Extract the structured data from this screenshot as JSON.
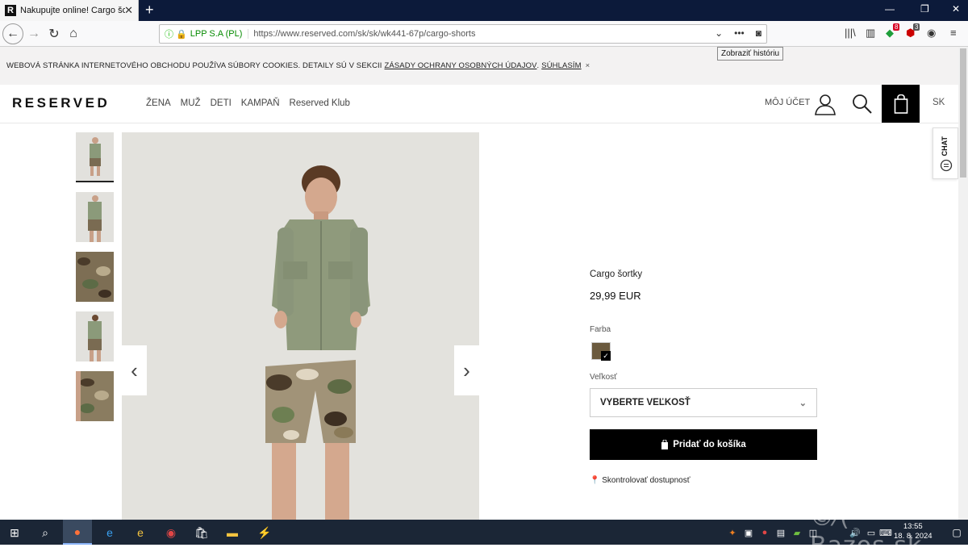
{
  "browser": {
    "tab_title": "Nakupujte online! Cargo šortky",
    "favicon_letter": "R",
    "site_identity": "LPP S.A (PL)",
    "url": "https://www.reserved.com/sk/sk/wk441-67p/cargo-shorts",
    "tooltip": "Zobraziť históriu",
    "badge_1": "8",
    "badge_2": "3"
  },
  "cookie_bar": {
    "text": "WEBOVÁ STRÁNKA INTERNETOVÉHO OBCHODU POUŽÍVA SÚBORY COOKIES. DETAILY SÚ V SEKCII",
    "link": "ZÁSADY OCHRANY OSOBNÝCH ÚDAJOV",
    "sep": ".",
    "accept": "SÚHLASÍM",
    "close": "×"
  },
  "header": {
    "logo": "RESERVED",
    "menu": [
      "ŽENA",
      "MUŽ",
      "DETI",
      "KAMPAŇ",
      "Reserved Klub"
    ],
    "account": "MÔJ ÚČET",
    "lang": "SK"
  },
  "chat": {
    "label": "CHAT"
  },
  "product": {
    "name": "Cargo šortky",
    "price": "29,99 EUR",
    "color_label": "Farba",
    "size_label": "Veľkosť",
    "size_select": "VYBERTE VEĽKOSŤ",
    "add_button": "Pridať do košíka",
    "availability": "Skontrolovať dostupnosť",
    "swatch_color": "#6b5a3e"
  },
  "taskbar": {
    "time": "13:55",
    "date": "18. 8. 2024"
  },
  "watermark": "Bazos.sk"
}
